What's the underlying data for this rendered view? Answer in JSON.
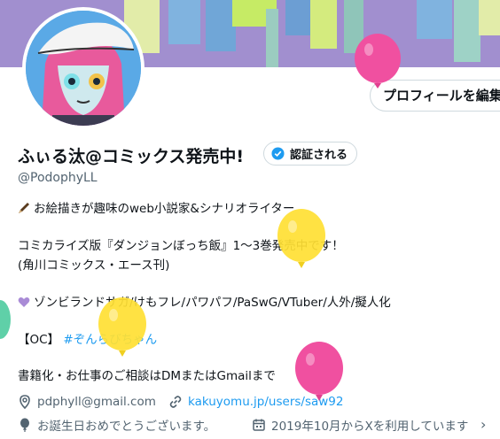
{
  "profile": {
    "edit_button": "プロフィールを編集",
    "display_name": "ふぃる汰@コミックス発売中!",
    "verify_label": "認証される",
    "handle": "@PodophyLL"
  },
  "bio": {
    "line1": "お絵描きが趣味のweb小説家&シナリオライター",
    "line2": "コミカライズ版『ダンジョンぼっち飯』1～3巻発売中です！",
    "line3": "(角川コミックス・エース刊)",
    "line4": "ゾンビランドサガ/けもフレ/パワパフ/PaSwG/VTuber/人外/擬人化",
    "oc_label": "【OC】",
    "oc_hashtag": "#ぞんらびちゃん",
    "line6": "書籍化・お仕事のご相談はDMまたはGmailまで"
  },
  "meta": {
    "email": "pdphyll@gmail.com",
    "url": "kakuyomu.jp/users/saw92",
    "birthday": "お誕生日おめでとうございます。",
    "joined": "2019年10月からXを利用しています"
  },
  "colors": {
    "accent": "#1d9bf0",
    "banner": "#a18fcf",
    "muted": "#536471"
  },
  "icons": [
    "pen-icon",
    "heart-icon",
    "location-icon",
    "link-icon",
    "balloon-icon",
    "calendar-icon",
    "verified-badge-icon",
    "chevron-right-icon"
  ]
}
